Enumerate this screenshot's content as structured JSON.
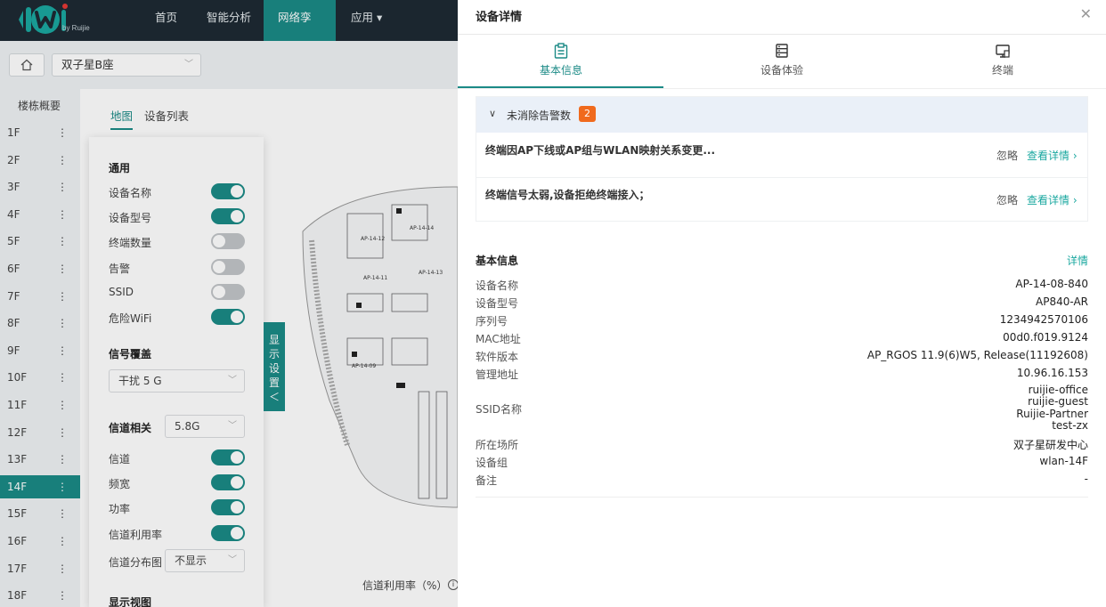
{
  "app": {
    "logo_text": "by Ruijie"
  },
  "nav": {
    "items": [
      "首页",
      "智能分析",
      "网络孪生",
      "应用 ▾"
    ]
  },
  "toolbar": {
    "building": "双子星B座"
  },
  "floors": {
    "title": "楼栋概要",
    "items": [
      "1F",
      "2F",
      "3F",
      "4F",
      "5F",
      "6F",
      "7F",
      "8F",
      "9F",
      "10F",
      "11F",
      "12F",
      "13F",
      "14F",
      "15F",
      "16F",
      "17F",
      "18F"
    ],
    "active": "14F"
  },
  "main": {
    "tab_map": "地图",
    "tab_list": "设备列表",
    "utilization_label": "信道利用率（%）"
  },
  "settings": {
    "general_title": "通用",
    "general": [
      {
        "label": "设备名称",
        "on": true
      },
      {
        "label": "设备型号",
        "on": true
      },
      {
        "label": "终端数量",
        "on": false
      },
      {
        "label": "告警",
        "on": false
      },
      {
        "label": "SSID",
        "on": false
      },
      {
        "label": "危险WiFi",
        "on": true
      }
    ],
    "coverage_title": "信号覆盖",
    "coverage_value": "干扰 5 G",
    "channel_title": "信道相关",
    "channel_band": "5.8G",
    "channel": [
      {
        "label": "信道",
        "on": true
      },
      {
        "label": "频宽",
        "on": true
      },
      {
        "label": "功率",
        "on": true
      },
      {
        "label": "信道利用率",
        "on": true
      }
    ],
    "distribution_label": "信道分布图",
    "distribution_value": "不显示",
    "view_title": "显示视图"
  },
  "sidetab": {
    "chars": [
      "显",
      "示",
      "设",
      "置",
      "＜"
    ]
  },
  "map_labels": [
    "AP-14-14",
    "AP-14-12",
    "AP-14-13",
    "AP-14-11",
    "AP-14-09"
  ],
  "drawer": {
    "title": "设备详情",
    "tabs": [
      "基本信息",
      "设备体验",
      "终端"
    ],
    "alarm_title": "未消除告警数",
    "alarm_count": "2",
    "alarms": [
      {
        "text": "终端因AP下线或AP组与WLAN映射关系变更...",
        "ignore": "忽略",
        "detail": "查看详情 ›"
      },
      {
        "text": "终端信号太弱,设备拒绝终端接入；",
        "ignore": "忽略",
        "detail": "查看详情 ›"
      }
    ],
    "basic_title": "基本信息",
    "basic_link": "详情",
    "fields": [
      {
        "k": "设备名称",
        "v": "AP-14-08-840"
      },
      {
        "k": "设备型号",
        "v": "AP840-AR"
      },
      {
        "k": "序列号",
        "v": "1234942570106"
      },
      {
        "k": "MAC地址",
        "v": "00d0.f019.9124"
      },
      {
        "k": "软件版本",
        "v": "AP_RGOS 11.9(6)W5, Release(11192608)"
      },
      {
        "k": "管理地址",
        "v": "10.96.16.153"
      }
    ],
    "ssid_label": "SSID名称",
    "ssids": [
      "ruijie-office",
      "ruijie-guest",
      "Ruijie-Partner",
      "test-zx"
    ],
    "fields2": [
      {
        "k": "所在场所",
        "v": "双子星研发中心"
      },
      {
        "k": "设备组",
        "v": "wlan-14F"
      },
      {
        "k": "备注",
        "v": "-"
      }
    ]
  },
  "colors": {
    "topbar": "#1e2a33",
    "accent": "#1b8a86",
    "badge": "#f06a1d",
    "link": "#1ba8a0"
  }
}
